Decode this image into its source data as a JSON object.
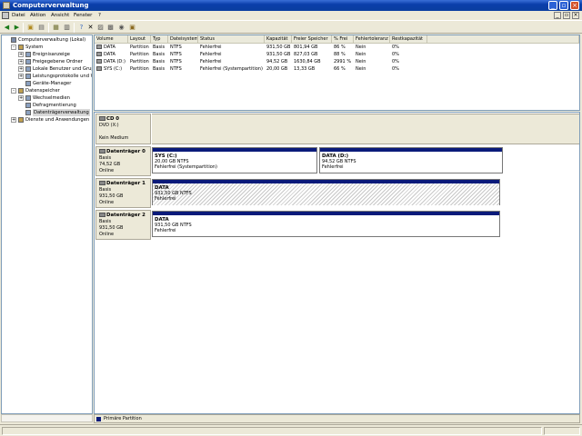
{
  "window": {
    "title": "Computerverwaltung"
  },
  "menu": [
    "Datei",
    "Aktion",
    "Ansicht",
    "Fenster",
    "?"
  ],
  "tree": [
    {
      "label": "Computerverwaltung (Lokal)",
      "level": 0,
      "expander": ""
    },
    {
      "label": "System",
      "level": 1,
      "expander": "-"
    },
    {
      "label": "Ereignisanzeige",
      "level": 2,
      "expander": "+"
    },
    {
      "label": "Freigegebene Ordner",
      "level": 2,
      "expander": "+"
    },
    {
      "label": "Lokale Benutzer und Gruppen",
      "level": 2,
      "expander": "+"
    },
    {
      "label": "Leistungsprotokolle und Warnungen",
      "level": 2,
      "expander": "+"
    },
    {
      "label": "Geräte-Manager",
      "level": 2,
      "expander": ""
    },
    {
      "label": "Datenspeicher",
      "level": 1,
      "expander": "-"
    },
    {
      "label": "Wechselmedien",
      "level": 2,
      "expander": "+"
    },
    {
      "label": "Defragmentierung",
      "level": 2,
      "expander": ""
    },
    {
      "label": "Datenträgerverwaltung",
      "level": 2,
      "expander": "",
      "selected": true
    },
    {
      "label": "Dienste und Anwendungen",
      "level": 1,
      "expander": "+"
    }
  ],
  "volumes": {
    "columns": [
      "Volume",
      "Layout",
      "Typ",
      "Dateisystem",
      "Status",
      "Kapazität",
      "Freier Speicher",
      "% Frei",
      "Fehlertoleranz",
      "Restkapazität"
    ],
    "rows": [
      [
        "DATA",
        "Partition",
        "Basis",
        "NTFS",
        "Fehlerfrei",
        "931,50 GB",
        "801,94 GB",
        "86 %",
        "Nein",
        "0%"
      ],
      [
        "DATA",
        "Partition",
        "Basis",
        "NTFS",
        "Fehlerfrei",
        "931,50 GB",
        "827,03 GB",
        "88 %",
        "Nein",
        "0%"
      ],
      [
        "DATA (D:)",
        "Partition",
        "Basis",
        "NTFS",
        "Fehlerfrei",
        "94,52 GB",
        "1630,84 GB",
        "2991 %",
        "Nein",
        "0%"
      ],
      [
        "SYS (C:)",
        "Partition",
        "Basis",
        "NTFS",
        "Fehlerfrei (Systempartition)",
        "20,00 GB",
        "13,33 GB",
        "66 %",
        "Nein",
        "0%"
      ]
    ]
  },
  "disks": [
    {
      "name": "CD 0",
      "lines": [
        "DVD (X:)",
        "",
        "Kein Medium"
      ],
      "partitions": []
    },
    {
      "name": "Datenträger 0",
      "lines": [
        "Basis",
        "74,52 GB",
        "Online"
      ],
      "partitions": [
        {
          "title": "SYS (C:)",
          "size": "20,00 GB NTFS",
          "status": "Fehlerfrei (Systempartition)",
          "hatched": false
        },
        {
          "title": "DATA (D:)",
          "size": "94,52 GB NTFS",
          "status": "Fehlerfrei",
          "hatched": false
        }
      ]
    },
    {
      "name": "Datenträger 1",
      "lines": [
        "Basis",
        "931,50 GB",
        "Online"
      ],
      "partitions": [
        {
          "title": "DATA",
          "size": "931,50 GB NTFS",
          "status": "Fehlerfrei",
          "hatched": true
        }
      ]
    },
    {
      "name": "Datenträger 2",
      "lines": [
        "Basis",
        "931,50 GB",
        "Online"
      ],
      "partitions": [
        {
          "title": "DATA",
          "size": "931,50 GB NTFS",
          "status": "Fehlerfrei",
          "hatched": false
        }
      ]
    }
  ],
  "legend": {
    "label": "Primäre Partition",
    "color": "#0a1a7a"
  },
  "icons": [
    "back-icon",
    "forward-icon",
    "up-icon",
    "show-hide-tree-icon",
    "properties-icon",
    "help-icon",
    "delete-icon",
    "disk-view-icon",
    "rescan-icon",
    "console-icon"
  ]
}
